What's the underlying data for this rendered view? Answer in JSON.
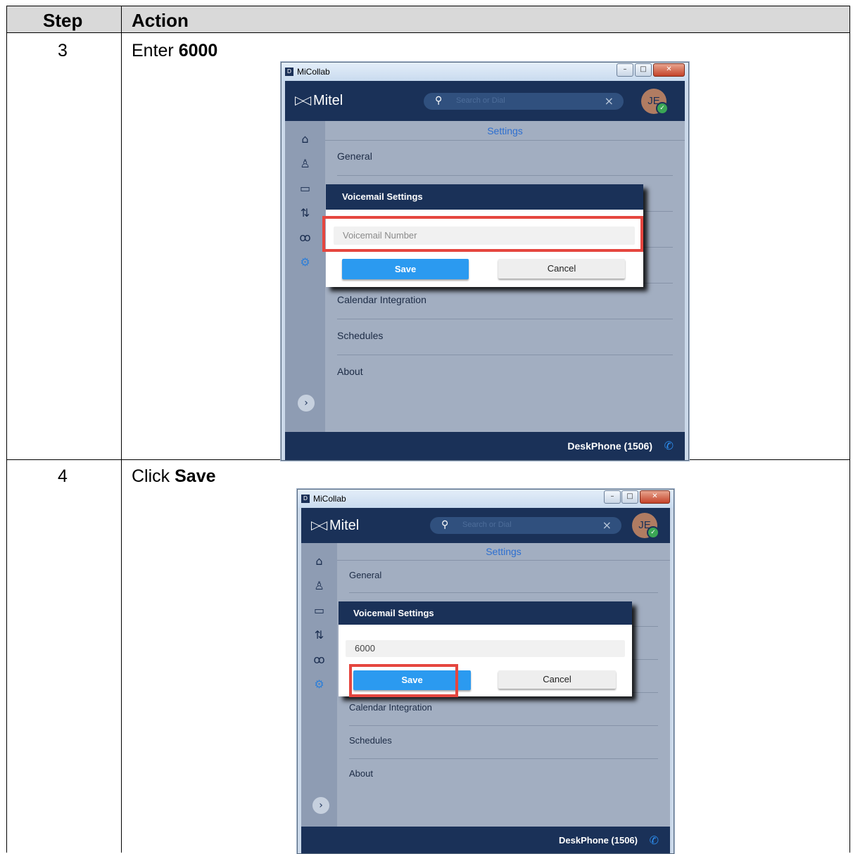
{
  "table": {
    "headers": {
      "step": "Step",
      "action": "Action"
    },
    "rows": [
      {
        "step": "3",
        "action_verb": "Enter",
        "action_target": "6000"
      },
      {
        "step": "4",
        "action_verb": "Click",
        "action_target": "Save"
      }
    ]
  },
  "screenshots": [
    {
      "window_title": "MiCollab",
      "brand": "Mitel",
      "search_placeholder": "Search or Dial",
      "user_initials": "JE",
      "page_title": "Settings",
      "menu": [
        "General",
        "Calendar Integration",
        "Schedules",
        "About"
      ],
      "dialog_title": "Voicemail Settings",
      "voicemail_field": "Voicemail Number",
      "save_label": "Save",
      "cancel_label": "Cancel",
      "device": "DeskPhone (1506)",
      "highlight": "voicemail-number-field"
    },
    {
      "window_title": "MiCollab",
      "brand": "Mitel",
      "search_placeholder": "Search or Dial",
      "user_initials": "JE",
      "page_title": "Settings",
      "menu": [
        "General",
        "Calendar Integration",
        "Schedules",
        "About"
      ],
      "dialog_title": "Voicemail Settings",
      "voicemail_field": "6000",
      "save_label": "Save",
      "cancel_label": "Cancel",
      "device": "DeskPhone (1506)",
      "highlight": "save-button"
    }
  ],
  "colors": {
    "header_fill": "#d9d9d9",
    "app_navy": "#1a3158",
    "accent_blue": "#2b9af0",
    "highlight_red": "#e5463f"
  },
  "icons": {
    "nav": [
      "home-icon",
      "contacts-icon",
      "chat-icon",
      "call-history-icon",
      "voicemail-icon",
      "settings-gear-icon"
    ],
    "other": [
      "search-icon",
      "clear-search-icon",
      "presence-check-icon",
      "expand-chevron-icon",
      "phone-icon"
    ]
  }
}
